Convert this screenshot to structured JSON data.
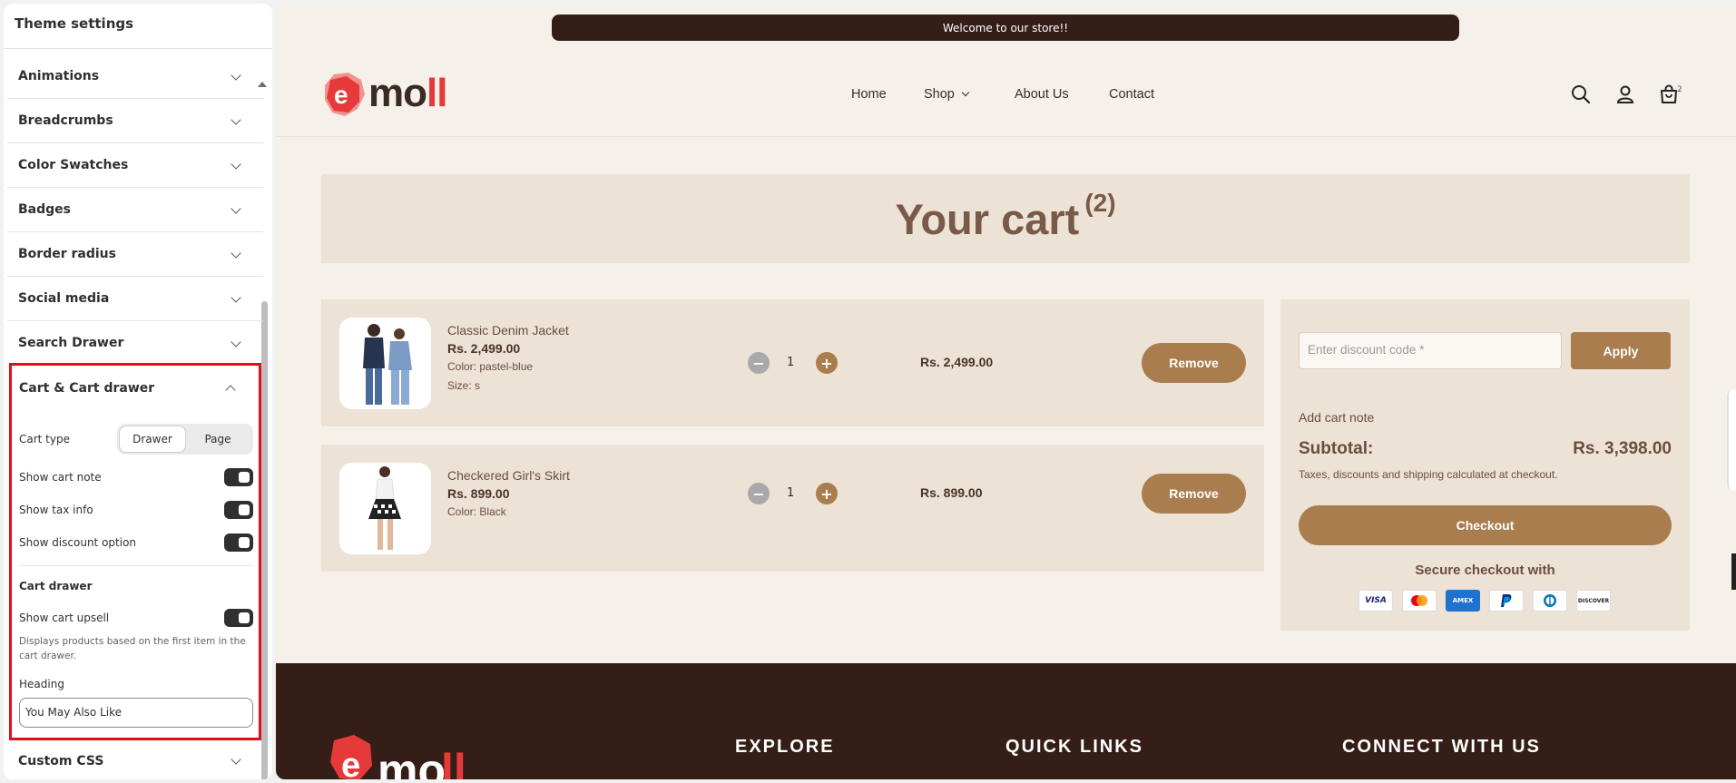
{
  "panel": {
    "title": "Theme settings",
    "sections": [
      {
        "label": "Animations"
      },
      {
        "label": "Breadcrumbs"
      },
      {
        "label": "Color Swatches"
      },
      {
        "label": "Badges"
      },
      {
        "label": "Border radius"
      },
      {
        "label": "Social media"
      },
      {
        "label": "Search Drawer"
      }
    ],
    "cart": {
      "label": "Cart & Cart drawer",
      "cart_type_label": "Cart type",
      "cart_type_options": [
        "Drawer",
        "Page"
      ],
      "cart_type_selected": "Drawer",
      "show_cart_note": "Show cart note",
      "show_tax_info": "Show tax info",
      "show_discount_option": "Show discount option",
      "drawer_heading": "Cart drawer",
      "show_cart_upsell": "Show cart upsell",
      "upsell_help": "Displays products based on the first item in the cart drawer.",
      "heading_label": "Heading",
      "heading_value": "You May Also Like"
    },
    "custom_css": "Custom CSS"
  },
  "store": {
    "announcement": "Welcome to our store!!",
    "logo_text_main": "mo",
    "logo_text_accent": "ll",
    "logo_letter": "e",
    "nav": [
      "Home",
      "Shop",
      "About Us",
      "Contact"
    ],
    "cart_count": "2",
    "cart_title": "Your cart",
    "cart_title_count": "(2)",
    "items": [
      {
        "name": "Classic Denim Jacket",
        "price": "Rs. 2,499.00",
        "meta": [
          "Color: pastel-blue",
          "Size: s"
        ],
        "qty": "1",
        "total": "Rs. 2,499.00",
        "remove": "Remove"
      },
      {
        "name": "Checkered Girl's Skirt",
        "price": "Rs. 899.00",
        "meta": [
          "Color: Black"
        ],
        "qty": "1",
        "total": "Rs. 899.00",
        "remove": "Remove"
      }
    ],
    "summary": {
      "discount_placeholder": "Enter discount code *",
      "apply": "Apply",
      "add_note": "Add cart note",
      "subtotal_label": "Subtotal:",
      "subtotal_value": "Rs. 3,398.00",
      "tax_note": "Taxes, discounts and shipping calculated at checkout.",
      "checkout": "Checkout",
      "secure": "Secure checkout with",
      "payment_methods": [
        "VISA",
        "Mastercard",
        "AMEX",
        "PayPal",
        "Diners",
        "DISCOVER"
      ]
    },
    "footer": {
      "explore": "EXPLORE",
      "quick_links": "QUICK LINKS",
      "connect": "CONNECT WITH US"
    }
  },
  "colors": {
    "accent": "#a97d4e",
    "dark": "#351e18",
    "cream": "#f5f1ea",
    "tan": "#ece2d5",
    "highlight_border": "#e0101a"
  }
}
